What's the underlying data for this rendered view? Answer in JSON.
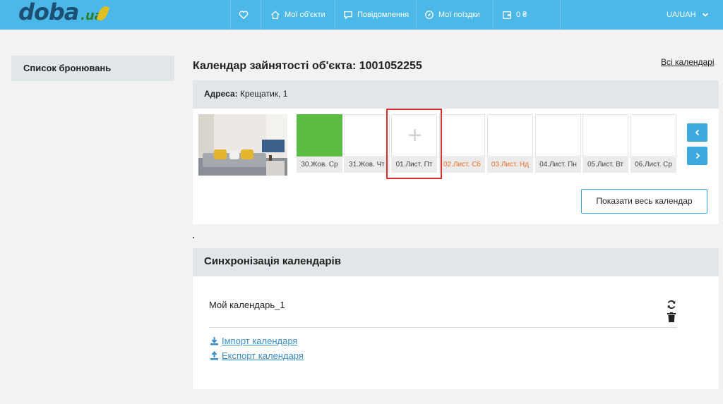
{
  "header": {
    "logo": "doba.ua",
    "nav": [
      {
        "label": "",
        "icon": "heart-icon"
      },
      {
        "label": "Мої об'єкти",
        "icon": "home-icon"
      },
      {
        "label": "Повідомлення",
        "icon": "message-icon"
      },
      {
        "label": "Мої поїздки",
        "icon": "compass-icon"
      },
      {
        "label": "0 ₴",
        "icon": "wallet-icon"
      }
    ],
    "lang": "UA/UAH"
  },
  "sidebar": {
    "items": [
      {
        "label": "Список бронювань"
      }
    ]
  },
  "main": {
    "title": "Календар зайнятості об'єкта: 1001052255",
    "all_calendars": "Всі календарі",
    "address_label": "Адреса:",
    "address_value": " Крещатик, 1",
    "days": [
      {
        "label": "30.Жов. Ср",
        "status": "busy",
        "weekend": false
      },
      {
        "label": "31.Жов. Чт",
        "status": "free",
        "weekend": false
      },
      {
        "label": "01.Лист. Пт",
        "status": "free",
        "weekend": false,
        "plus": "+"
      },
      {
        "label": "02.Лист. Сб",
        "status": "free",
        "weekend": true
      },
      {
        "label": "03.Лист. Нд",
        "status": "free",
        "weekend": true
      },
      {
        "label": "04.Лист. Пн",
        "status": "free",
        "weekend": false
      },
      {
        "label": "05.Лист. Вт",
        "status": "free",
        "weekend": false
      },
      {
        "label": "06.Лист. Ср",
        "status": "free",
        "weekend": false
      }
    ],
    "show_all": "Показати весь календар",
    "sync": {
      "title": "Синхронізація календарів",
      "calendar_name": "Мой календарь_1",
      "import": "Імпорт календаря",
      "export": "Експорт календаря"
    }
  },
  "colors": {
    "header": "#4bb8e8",
    "busy": "#5cbd45",
    "weekend": "#f07028",
    "accent": "#3ba8de",
    "highlight": "#d9302c"
  }
}
